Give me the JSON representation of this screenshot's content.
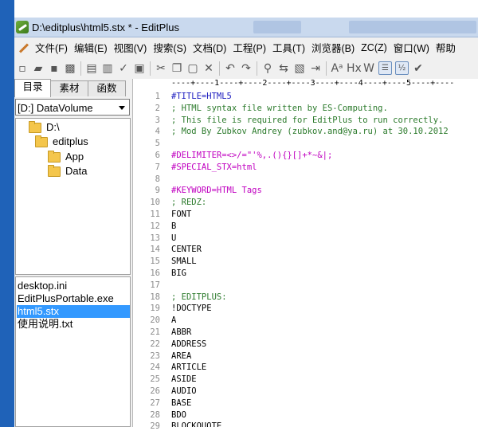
{
  "window": {
    "title": "D:\\editplus\\html5.stx * - EditPlus"
  },
  "menu": [
    "文件(F)",
    "编辑(E)",
    "视图(V)",
    "搜索(S)",
    "文档(D)",
    "工程(P)",
    "工具(T)",
    "浏览器(B)",
    "ZC(Z)",
    "窗口(W)",
    "帮助"
  ],
  "toolbar": [
    {
      "name": "new-file-icon",
      "glyph": "▫"
    },
    {
      "name": "open-folder-icon",
      "glyph": "▰"
    },
    {
      "name": "save-icon",
      "glyph": "▪"
    },
    {
      "name": "save-all-icon",
      "glyph": "▩"
    },
    {
      "name": "sep",
      "glyph": ""
    },
    {
      "name": "print-preview-icon",
      "glyph": "▤"
    },
    {
      "name": "print-icon",
      "glyph": "▥"
    },
    {
      "name": "spell-check-icon",
      "glyph": "✓"
    },
    {
      "name": "browser-icon",
      "glyph": "▣"
    },
    {
      "name": "sep",
      "glyph": ""
    },
    {
      "name": "cut-icon",
      "glyph": "✂"
    },
    {
      "name": "copy-icon",
      "glyph": "❐"
    },
    {
      "name": "paste-icon",
      "glyph": "▢"
    },
    {
      "name": "delete-icon",
      "glyph": "✕"
    },
    {
      "name": "sep",
      "glyph": ""
    },
    {
      "name": "undo-icon",
      "glyph": "↶"
    },
    {
      "name": "redo-icon",
      "glyph": "↷"
    },
    {
      "name": "sep",
      "glyph": ""
    },
    {
      "name": "find-icon",
      "glyph": "⚲"
    },
    {
      "name": "replace-icon",
      "glyph": "⇆"
    },
    {
      "name": "find-in-files-icon",
      "glyph": "▧"
    },
    {
      "name": "goto-line-icon",
      "glyph": "⇥"
    },
    {
      "name": "sep",
      "glyph": ""
    },
    {
      "name": "font-icon",
      "glyph": "Aᵃ"
    },
    {
      "name": "hex-icon",
      "glyph": "Hx"
    },
    {
      "name": "wordwrap-icon",
      "glyph": "W"
    },
    {
      "name": "line-numbers-icon",
      "glyph": "☰"
    },
    {
      "name": "column-marker-icon",
      "glyph": "½"
    },
    {
      "name": "check-icon",
      "glyph": "✔"
    }
  ],
  "left_pane": {
    "tabs": [
      "目录",
      "素材",
      "函数"
    ],
    "drive": "[D:] DataVolume",
    "tree": [
      "D:\\",
      "editplus",
      "App",
      "Data"
    ],
    "files": [
      "desktop.ini",
      "EditPlusPortable.exe",
      "html5.stx",
      "使用说明.txt"
    ]
  },
  "editor": {
    "ruler": "----+----1----+----2----+----3----+----4----+----5----+----",
    "lines": [
      {
        "n": "1",
        "t": "#TITLE=HTML5",
        "s": "k"
      },
      {
        "n": "2",
        "t": "; HTML syntax file written by ES-Computing.",
        "s": "c"
      },
      {
        "n": "3",
        "t": "; This file is required for EditPlus to run correctly.",
        "s": "c"
      },
      {
        "n": "4",
        "t": "; Mod By Zubkov Andrey (zubkov.and@ya.ru) at 30.10.2012",
        "s": "c"
      },
      {
        "n": "5",
        "t": "",
        "s": ""
      },
      {
        "n": "6",
        "t": "#DELIMITER=<>/=\"'%,.(){}[]+*~&|;",
        "s": "m"
      },
      {
        "n": "7",
        "t": "#SPECIAL_STX=html",
        "s": "m"
      },
      {
        "n": "8",
        "t": "",
        "s": ""
      },
      {
        "n": "9",
        "t": "#KEYWORD=HTML Tags",
        "s": "m"
      },
      {
        "n": "10",
        "t": "; REDZ:",
        "s": "c"
      },
      {
        "n": "11",
        "t": "FONT",
        "s": ""
      },
      {
        "n": "12",
        "t": "B",
        "s": ""
      },
      {
        "n": "13",
        "t": "U",
        "s": ""
      },
      {
        "n": "14",
        "t": "CENTER",
        "s": ""
      },
      {
        "n": "15",
        "t": "SMALL",
        "s": ""
      },
      {
        "n": "16",
        "t": "BIG",
        "s": ""
      },
      {
        "n": "17",
        "t": "",
        "s": ""
      },
      {
        "n": "18",
        "t": "; EDITPLUS:",
        "s": "c"
      },
      {
        "n": "19",
        "t": "!DOCTYPE",
        "s": ""
      },
      {
        "n": "20",
        "t": "A",
        "s": ""
      },
      {
        "n": "21",
        "t": "ABBR",
        "s": ""
      },
      {
        "n": "22",
        "t": "ADDRESS",
        "s": ""
      },
      {
        "n": "23",
        "t": "AREA",
        "s": ""
      },
      {
        "n": "24",
        "t": "ARTICLE",
        "s": ""
      },
      {
        "n": "25",
        "t": "ASIDE",
        "s": ""
      },
      {
        "n": "26",
        "t": "AUDIO",
        "s": ""
      },
      {
        "n": "27",
        "t": "BASE",
        "s": ""
      },
      {
        "n": "28",
        "t": "BDO",
        "s": ""
      },
      {
        "n": "29",
        "t": "BLOCKQUOTE",
        "s": ""
      }
    ]
  }
}
